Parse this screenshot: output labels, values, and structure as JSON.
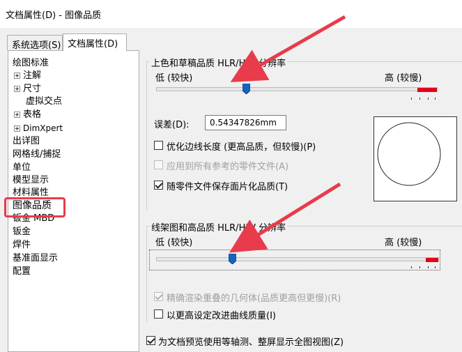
{
  "window": {
    "title": "文档属性(D) - 图像品质"
  },
  "tabs": [
    {
      "label": "系统选项(S)",
      "active": false
    },
    {
      "label": "文档属性(D)",
      "active": true
    }
  ],
  "tree": {
    "items": [
      {
        "label": "绘图标准",
        "level": 0,
        "expandable": false
      },
      {
        "label": "注解",
        "level": 1,
        "expandable": true
      },
      {
        "label": "尺寸",
        "level": 1,
        "expandable": true
      },
      {
        "label": "虚拟交点",
        "level": 2,
        "expandable": false
      },
      {
        "label": "表格",
        "level": 1,
        "expandable": true
      },
      {
        "label": "DimXpert",
        "level": 1,
        "expandable": true
      },
      {
        "label": "出详图",
        "level": 0,
        "expandable": false
      },
      {
        "label": "网格线/捕捉",
        "level": 0,
        "expandable": false
      },
      {
        "label": "单位",
        "level": 0,
        "expandable": false
      },
      {
        "label": "模型显示",
        "level": 0,
        "expandable": false
      },
      {
        "label": "材料属性",
        "level": 0,
        "expandable": false
      },
      {
        "label": "图像品质",
        "level": 0,
        "expandable": false,
        "selected": true
      },
      {
        "label": "钣金 MBD",
        "level": 0,
        "expandable": false
      },
      {
        "label": "钣金",
        "level": 0,
        "expandable": false
      },
      {
        "label": "焊件",
        "level": 0,
        "expandable": false
      },
      {
        "label": "基准面显示",
        "level": 0,
        "expandable": false
      },
      {
        "label": "配置",
        "level": 0,
        "expandable": false
      }
    ]
  },
  "shaded": {
    "group_title": "上色和草稿品质 HLR/HLV 分辨率",
    "low_label": "低 (较快)",
    "high_label": "高 (较慢)",
    "slider_position": 0.32,
    "deviation_label": "误差(D):",
    "deviation_value": "0.54347826mm",
    "optimize_label": "优化边线长度 (更高品质，但较慢)(P)",
    "optimize_checked": false,
    "apply_all_label": "应用到所有参考的零件文件(A)",
    "apply_all_checked": false,
    "apply_all_disabled": true,
    "save_tess_label": "随零件文件保存面片化品质(T)",
    "save_tess_checked": true
  },
  "wireframe": {
    "group_title": "线架图和高品质 HLR/HLV 分辨率",
    "low_label": "低 (较快)",
    "high_label": "高 (较慢)",
    "slider_position": 0.27,
    "precise_label": "精确渲染重叠的几何体(品质更高但更慢)(R)",
    "precise_checked": true,
    "precise_disabled": true,
    "improve_curve_label": "以更高设定改进曲线质量(I)",
    "improve_curve_checked": false
  },
  "footer": {
    "preview_label": "为文档预览使用等轴测、整屏显示全图视图(Z)",
    "preview_checked": true
  },
  "colors": {
    "annotation": "#e83b4b",
    "slider_high": "#e5001a",
    "thumb": "#1565c0"
  }
}
